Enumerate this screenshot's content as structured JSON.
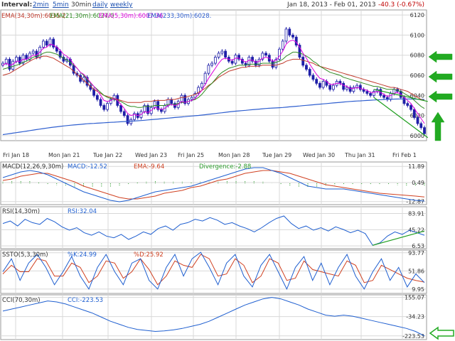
{
  "toolbar": {
    "interval_label": "Interval:",
    "intervals": [
      "2min",
      "5min",
      "30min",
      "daily",
      "weekly"
    ],
    "active_interval": "30min",
    "date_range": "Jan 18, 2013  -  Feb 01, 2013",
    "change": "-40.3 (-0.67%)"
  },
  "colors": {
    "price": "#1f1fa8",
    "ema34": "#c0392b",
    "ema21": "#2e8b22",
    "ema5": "#dd00dd",
    "ema233": "#2f5fcf",
    "macd": "#1f5fd0",
    "signal": "#d04020",
    "hist": "#2e9e2e",
    "trend": "#1e9e1e",
    "arrow": "#22aa22",
    "grid": "#d8d8d8",
    "text": "#333333"
  },
  "arrow_icons": [
    "arrow-left-icon",
    "arrow-left-icon",
    "arrow-left-icon",
    "arrow-up-icon",
    "arrow-left-outline-icon"
  ],
  "chart_data": [
    {
      "type": "line",
      "panel": "price",
      "ylim": [
        5995,
        6125
      ],
      "yticks": [
        6000,
        6020,
        6040,
        6060,
        6080,
        6100,
        6120
      ],
      "ytick_labels": [
        "6000",
        "6020",
        "6040",
        "6060",
        "6080",
        "6100",
        "6120"
      ],
      "xtick_labels": [
        "Fri Jan 18",
        "Mon Jan 21",
        "Tue Jan 22",
        "Wed Jan 23",
        "Fri Jan 25",
        "Mon Jan 28",
        "Tue Jan 29",
        "Wed Jan 30",
        "Thu Jan 31",
        "Fri Feb 1"
      ],
      "legend": [
        "EMA(34,30m):6035.2",
        "EMA(21,30m):6027.0",
        "EMA(5,30m):6007.36",
        "EMA(233,30m):6028."
      ],
      "candles": [
        6072,
        6076,
        6066,
        6074,
        6078,
        6072,
        6080,
        6076,
        6082,
        6084,
        6078,
        6088,
        6094,
        6090,
        6096,
        6088,
        6084,
        6078,
        6074,
        6076,
        6070,
        6062,
        6060,
        6054,
        6058,
        6050,
        6046,
        6040,
        6036,
        6030,
        6026,
        6032,
        6036,
        6040,
        6030,
        6024,
        6020,
        6012,
        6016,
        6022,
        6018,
        6024,
        6030,
        6022,
        6028,
        6034,
        6026,
        6024,
        6030,
        6036,
        6032,
        6028,
        6034,
        6040,
        6032,
        6036,
        6038,
        6042,
        6048,
        6052,
        6062,
        6070,
        6072,
        6078,
        6082,
        6084,
        6078,
        6074,
        6072,
        6080,
        6076,
        6072,
        6070,
        6078,
        6074,
        6070,
        6076,
        6082,
        6080,
        6074,
        6068,
        6076,
        6086,
        6094,
        6106,
        6100,
        6098,
        6090,
        6078,
        6070,
        6066,
        6060,
        6056,
        6052,
        6048,
        6054,
        6050,
        6046,
        6050,
        6054,
        6052,
        6046,
        6048,
        6044,
        6048,
        6050,
        6046,
        6044,
        6042,
        6040,
        6044,
        6046,
        6040,
        6038,
        6036,
        6042,
        6046,
        6044,
        6038,
        6032,
        6030,
        6026,
        6018,
        6012,
        6008,
        6002
      ],
      "ema34": [
        6060,
        6061,
        6062,
        6064,
        6066,
        6068,
        6070,
        6072,
        6074,
        6076,
        6077,
        6078,
        6079,
        6079,
        6078,
        6077,
        6075,
        6073,
        6071,
        6069,
        6067,
        6064,
        6061,
        6058,
        6055,
        6052,
        6049,
        6046,
        6044,
        6042,
        6040,
        6039,
        6038,
        6037,
        6036,
        6035,
        6034,
        6033,
        6033,
        6033,
        6033,
        6033,
        6034,
        6034,
        6034,
        6035,
        6035,
        6035,
        6035,
        6036,
        6036,
        6036,
        6037,
        6038,
        6038,
        6039,
        6040,
        6041,
        6043,
        6045,
        6047,
        6050,
        6052,
        6055,
        6058,
        6060,
        6062,
        6064,
        6065,
        6066,
        6067,
        6068,
        6068,
        6069,
        6069,
        6069,
        6069,
        6070,
        6070,
        6070,
        6070,
        6070,
        6071,
        6072,
        6074,
        6075,
        6076,
        6076,
        6076,
        6075,
        6074,
        6073,
        6072,
        6070,
        6069,
        6068,
        6067,
        6066,
        6065,
        6064,
        6063,
        6062,
        6061,
        6060,
        6059,
        6058,
        6057,
        6056,
        6055,
        6054,
        6053,
        6052,
        6051,
        6050,
        6049,
        6048,
        6048,
        6047,
        6046,
        6045,
        6044,
        6042,
        6040,
        6038,
        6036,
        6035
      ],
      "ema21": [
        6066,
        6067,
        6068,
        6069,
        6070,
        6071,
        6073,
        6074,
        6076,
        6078,
        6079,
        6080,
        6082,
        6083,
        6083,
        6082,
        6081,
        6079,
        6077,
        6075,
        6073,
        6070,
        6067,
        6063,
        6060,
        6056,
        6052,
        6049,
        6046,
        6043,
        6040,
        6038,
        6037,
        6036,
        6035,
        6034,
        6032,
        6030,
        6029,
        6029,
        6028,
        6028,
        6029,
        6029,
        6029,
        6030,
        6030,
        6030,
        6030,
        6031,
        6031,
        6031,
        6032,
        6033,
        6033,
        6034,
        6035,
        6036,
        6038,
        6041,
        6045,
        6049,
        6052,
        6056,
        6060,
        6063,
        6065,
        6067,
        6068,
        6069,
        6070,
        6070,
        6070,
        6071,
        6071,
        6071,
        6071,
        6072,
        6072,
        6072,
        6072,
        6073,
        6074,
        6076,
        6079,
        6081,
        6083,
        6083,
        6082,
        6081,
        6079,
        6077,
        6074,
        6072,
        6069,
        6067,
        6065,
        6063,
        6062,
        6061,
        6060,
        6058,
        6057,
        6056,
        6055,
        6054,
        6053,
        6052,
        6051,
        6050,
        6049,
        6049,
        6048,
        6047,
        6046,
        6046,
        6046,
        6045,
        6044,
        6042,
        6040,
        6038,
        6035,
        6032,
        6029,
        6027
      ],
      "ema5": [
        6070,
        6072,
        6070,
        6071,
        6074,
        6074,
        6076,
        6076,
        6078,
        6080,
        6080,
        6083,
        6087,
        6088,
        6091,
        6090,
        6088,
        6085,
        6081,
        6079,
        6076,
        6071,
        6067,
        6063,
        6061,
        6057,
        6053,
        6049,
        6045,
        6040,
        6035,
        6034,
        6035,
        6037,
        6035,
        6031,
        6027,
        6022,
        6020,
        6021,
        6020,
        6021,
        6024,
        6023,
        6025,
        6028,
        6027,
        6026,
        6027,
        6030,
        6031,
        6030,
        6031,
        6034,
        6033,
        6034,
        6035,
        6037,
        6041,
        6045,
        6051,
        6057,
        6062,
        6067,
        6072,
        6076,
        6077,
        6076,
        6075,
        6077,
        6077,
        6075,
        6073,
        6075,
        6075,
        6073,
        6074,
        6077,
        6078,
        6077,
        6074,
        6075,
        6079,
        6084,
        6091,
        6094,
        6095,
        6093,
        6088,
        6082,
        6077,
        6071,
        6066,
        6061,
        6057,
        6056,
        6054,
        6051,
        6051,
        6052,
        6052,
        6050,
        6049,
        6047,
        6047,
        6048,
        6047,
        6046,
        6045,
        6043,
        6043,
        6044,
        6043,
        6041,
        6039,
        6040,
        6042,
        6043,
        6041,
        6038,
        6035,
        6032,
        6027,
        6022,
        6017,
        6012
      ],
      "ema233": [
        6001,
        6001.5,
        6002,
        6002.5,
        6003,
        6003.5,
        6004,
        6004.5,
        6005,
        6005.5,
        6006,
        6006.5,
        6007,
        6007.5,
        6008,
        6008.4,
        6008.8,
        6009.2,
        6009.6,
        6010,
        6010.3,
        6010.6,
        6010.9,
        6011.2,
        6011.5,
        6011.8,
        6012,
        6012.2,
        6012.4,
        6012.6,
        6012.8,
        6013,
        6013.2,
        6013.4,
        6013.6,
        6013.8,
        6014,
        6014.2,
        6014.4,
        6014.6,
        6014.8,
        6015,
        6015.3,
        6015.6,
        6015.9,
        6016.2,
        6016.5,
        6016.8,
        6017.1,
        6017.4,
        6017.7,
        6018,
        6018.3,
        6018.6,
        6018.9,
        6019.2,
        6019.5,
        6019.8,
        6020.1,
        6020.4,
        6020.8,
        6021.2,
        6021.6,
        6022,
        6022.4,
        6022.8,
        6023.2,
        6023.6,
        6024,
        6024.3,
        6024.6,
        6024.9,
        6025.2,
        6025.5,
        6025.8,
        6026.1,
        6026.4,
        6026.7,
        6027,
        6027.2,
        6027.4,
        6027.6,
        6027.8,
        6028,
        6028.3,
        6028.6,
        6028.9,
        6029.2,
        6029.5,
        6029.8,
        6030.1,
        6030.4,
        6030.7,
        6031,
        6031.3,
        6031.6,
        6031.9,
        6032.2,
        6032.5,
        6032.8,
        6033.1,
        6033.4,
        6033.7,
        6034,
        6034.2,
        6034.4,
        6034.6,
        6034.8,
        6035,
        6035.2,
        6035.4,
        6035.6,
        6035.8,
        6036,
        6036.1,
        6036.2,
        6036.3,
        6036.4,
        6036.5,
        6036.5,
        6036.5,
        6036.4,
        6036.3,
        6036.2,
        6036.1,
        6036
      ],
      "trendlines": [
        {
          "from": [
            110,
            6046
          ],
          "to": [
            126,
            6034
          ]
        },
        {
          "from": [
            110,
            6038
          ],
          "to": [
            126,
            5998
          ]
        }
      ]
    },
    {
      "type": "line",
      "panel": "macd",
      "legend": [
        "MACD(12,26,9,30m)",
        "MACD:-12.52",
        "EMA:-9.64",
        "Divergence:-2.88"
      ],
      "ylim": [
        -15,
        15
      ],
      "yticks": [
        11.89,
        0.49,
        -12.87
      ],
      "ytick_labels": [
        "11.89",
        "0.49",
        "-12.87"
      ],
      "macd": [
        4,
        6,
        8,
        9,
        8,
        6,
        3,
        0,
        -3,
        -6,
        -8,
        -10,
        -12,
        -13,
        -12,
        -10,
        -8,
        -6,
        -5,
        -4,
        -3,
        -2,
        0,
        2,
        4,
        6,
        8,
        10,
        11,
        11,
        9,
        7,
        4,
        1,
        -2,
        -3,
        -4,
        -4,
        -4,
        -5,
        -6,
        -7,
        -8,
        -9,
        -10,
        -11,
        -12,
        -12.5
      ],
      "signal": [
        2,
        3,
        5,
        6,
        7,
        7,
        5,
        3,
        1,
        -2,
        -4,
        -6,
        -8,
        -10,
        -11,
        -11,
        -10,
        -9,
        -7,
        -6,
        -5,
        -3,
        -2,
        0,
        2,
        3,
        5,
        7,
        8,
        9,
        9,
        8,
        7,
        5,
        3,
        1,
        -1,
        -2,
        -3,
        -4,
        -5,
        -6,
        -7,
        -7.5,
        -8,
        -8.5,
        -9,
        -9.6
      ]
    },
    {
      "type": "line",
      "panel": "rsi",
      "legend": [
        "RSI(14,30m)",
        "RSI:32.04"
      ],
      "ylim": [
        0,
        100
      ],
      "yticks": [
        83.91,
        45.22,
        6.53
      ],
      "ytick_labels": [
        "83.91",
        "45.22",
        "6.53"
      ],
      "values": [
        60,
        66,
        54,
        70,
        62,
        58,
        72,
        64,
        52,
        44,
        50,
        38,
        32,
        40,
        30,
        26,
        34,
        22,
        30,
        40,
        34,
        48,
        54,
        44,
        58,
        62,
        70,
        66,
        74,
        68,
        58,
        62,
        54,
        48,
        40,
        50,
        62,
        72,
        78,
        60,
        48,
        54,
        44,
        50,
        42,
        52,
        46,
        38,
        44,
        36,
        8,
        14,
        30,
        40,
        34,
        44,
        38,
        32
      ],
      "trendline": {
        "from": [
          50,
          8
        ],
        "to": [
          57,
          42
        ]
      }
    },
    {
      "type": "line",
      "panel": "ssto",
      "legend": [
        "SSTO(5,3,30m)",
        "%K:24.99",
        "%D:25.92"
      ],
      "ylim": [
        0,
        100
      ],
      "yticks": [
        93.77,
        51.86,
        9.95
      ],
      "ytick_labels": [
        "93.77",
        "51.86",
        "9.95"
      ],
      "k": [
        50,
        80,
        30,
        70,
        90,
        60,
        20,
        50,
        85,
        40,
        10,
        60,
        90,
        50,
        20,
        70,
        80,
        30,
        10,
        60,
        90,
        40,
        80,
        95,
        60,
        20,
        70,
        90,
        40,
        15,
        65,
        90,
        50,
        10,
        60,
        85,
        30,
        70,
        20,
        60,
        90,
        40,
        10,
        50,
        80,
        30,
        60,
        15,
        45,
        25
      ],
      "d": [
        45,
        65,
        50,
        50,
        80,
        75,
        40,
        40,
        70,
        60,
        25,
        40,
        75,
        70,
        35,
        50,
        80,
        55,
        20,
        40,
        75,
        65,
        60,
        90,
        80,
        40,
        45,
        80,
        65,
        25,
        40,
        80,
        70,
        30,
        35,
        75,
        55,
        50,
        45,
        40,
        75,
        65,
        25,
        30,
        65,
        55,
        45,
        35,
        30,
        26
      ]
    },
    {
      "type": "line",
      "panel": "cci",
      "legend": [
        "CCI(70,30m)",
        "CCI:-223.53"
      ],
      "ylim": [
        -260,
        180
      ],
      "yticks": [
        155.07,
        -34.23,
        -223.53
      ],
      "ytick_labels": [
        "155.07",
        "-34.23",
        "-223.53"
      ],
      "values": [
        20,
        40,
        60,
        80,
        100,
        120,
        110,
        90,
        60,
        30,
        0,
        -40,
        -80,
        -110,
        -140,
        -160,
        -170,
        -180,
        -175,
        -165,
        -150,
        -130,
        -110,
        -80,
        -40,
        0,
        40,
        80,
        110,
        140,
        155,
        140,
        110,
        80,
        40,
        10,
        -20,
        -30,
        -20,
        -30,
        -50,
        -70,
        -90,
        -110,
        -130,
        -150,
        -180,
        -223.53
      ]
    }
  ]
}
